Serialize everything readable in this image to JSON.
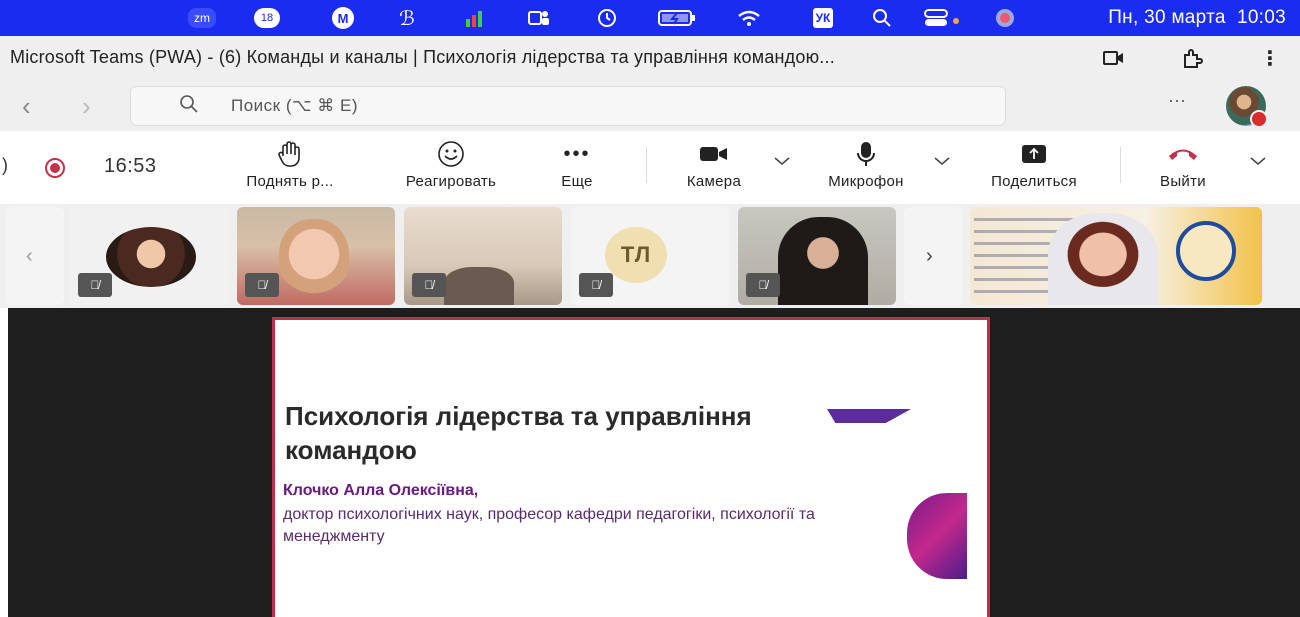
{
  "menubar": {
    "apps": [
      "zm",
      "18",
      "M",
      "ℬ",
      "",
      "",
      "",
      "",
      "",
      "УК",
      "",
      ""
    ],
    "date": "Пн, 30 марта",
    "time": "10:03"
  },
  "window": {
    "title": "Microsoft Teams (PWA) - (6) Команды и каналы | Психологія лідерства та управління командою..."
  },
  "nav": {
    "search_placeholder": "Поиск (⌥ ⌘ E)"
  },
  "meeting": {
    "timer": "16:53",
    "buttons": {
      "raise_hand": "Поднять р...",
      "react": "Реагировать",
      "more": "Еще",
      "camera": "Камера",
      "mic": "Микрофон",
      "share": "Поделиться",
      "leave": "Выйти"
    }
  },
  "participants": {
    "initials_tile": "ТЛ"
  },
  "slide": {
    "title": "Психологія лідерства та управління командою",
    "author": "Клочко Алла Олексіївна,",
    "description": "доктор психологічних наук, професор кафедри педагогіки, психології та менеджменту"
  },
  "colors": {
    "menubar": "#1a2cf0",
    "leave_red": "#c4314b",
    "slide_border": "#b8334a",
    "author_purple": "#6a1a80"
  }
}
